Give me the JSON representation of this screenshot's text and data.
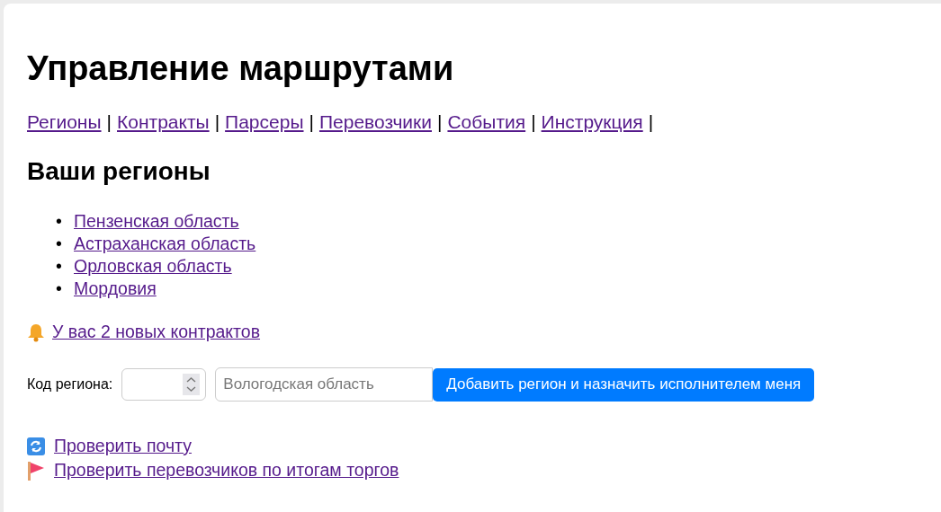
{
  "title": "Управление маршрутами",
  "nav": [
    {
      "label": "Регионы",
      "separator": "|"
    },
    {
      "label": "Контракты",
      "separator": "|"
    },
    {
      "label": "Парсеры",
      "separator": "|"
    },
    {
      "label": "Перевозчики",
      "separator": "|"
    },
    {
      "label": "События",
      "separator": "|"
    },
    {
      "label": "Инструкция",
      "separator": "|"
    }
  ],
  "regions_heading": "Ваши регионы",
  "regions": [
    {
      "marker": "•",
      "name": "Пензенская область"
    },
    {
      "marker": "•",
      "name": "Астраханская область"
    },
    {
      "marker": "•",
      "name": "Орловская область"
    },
    {
      "marker": "•",
      "name": "Мордовия"
    }
  ],
  "notice": {
    "kind": "bell",
    "link": "У вас 2 новых контрактов"
  },
  "form": {
    "label": "Код региона:",
    "name_placeholder": "Вологодская область",
    "button": "Добавить регион и назначить исполнителем меня"
  },
  "actions": [
    {
      "kind": "refresh",
      "label": "Проверить почту"
    },
    {
      "kind": "flag",
      "label": "Проверить перевозчиков по итогам торгов"
    }
  ]
}
